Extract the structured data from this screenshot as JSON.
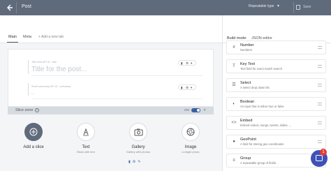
{
  "header": {
    "title": "Post",
    "type_select": "Repeatable type",
    "save_label": "Save"
  },
  "tabs": {
    "main": "Main",
    "meta": "Meta",
    "add": "+ Add a new tab"
  },
  "card": {
    "title_field_label": "Title field API ID : title",
    "title_placeholder": "Title for the post...",
    "summary_field_label": "Short summary API ID : summary",
    "dash": "..."
  },
  "slice_zone": {
    "label": "Slice zone",
    "toggle_label": "ON"
  },
  "slice_options": [
    {
      "title": "Add a slice",
      "desc": ""
    },
    {
      "title": "Text",
      "desc": "Block with text"
    },
    {
      "title": "Gallery",
      "desc": "Gallery with photos"
    },
    {
      "title": "Image",
      "desc": "a single photo"
    }
  ],
  "right_panel": {
    "tabs": [
      "Build mode",
      "JSON editor"
    ],
    "items": [
      {
        "name": "Number",
        "desc": "Numbers",
        "icon": "number-icon"
      },
      {
        "name": "Key Text",
        "desc": "Text field for exact match search",
        "icon": "key-text-icon"
      },
      {
        "name": "Select",
        "desc": "A select drop down list",
        "icon": "select-icon"
      },
      {
        "name": "Boolean",
        "desc": "An input that is either true or false",
        "icon": "boolean-icon"
      },
      {
        "name": "Embed",
        "desc": "Embed videos, songs, tweets, slides, ...",
        "icon": "embed-icon"
      },
      {
        "name": "GeoPoint",
        "desc": "A field for storing geo-coordinates",
        "icon": "geopoint-icon"
      },
      {
        "name": "Group",
        "desc": "A repeatable group of fields",
        "icon": "group-icon"
      }
    ]
  },
  "chat": {
    "badge": "1"
  }
}
